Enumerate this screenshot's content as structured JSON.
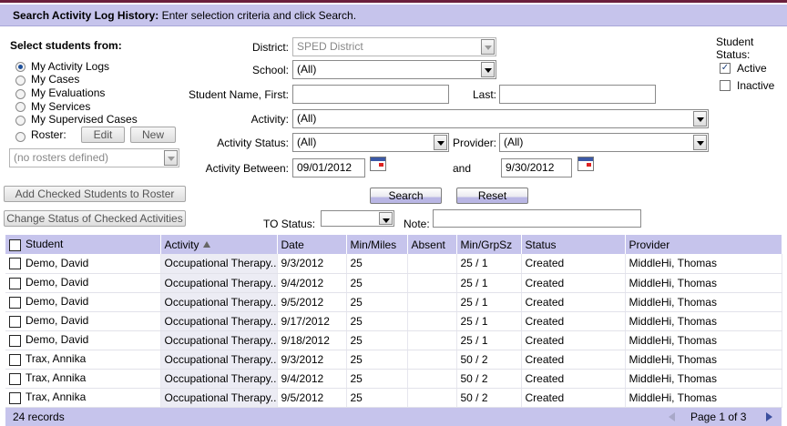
{
  "header": {
    "title": "Search Activity Log History:",
    "instruction": "Enter selection criteria and click Search."
  },
  "select_from": {
    "heading": "Select students from:",
    "options": [
      {
        "label": "My Activity Logs",
        "selected": true
      },
      {
        "label": "My Cases",
        "selected": false
      },
      {
        "label": "My Evaluations",
        "selected": false
      },
      {
        "label": "My Services",
        "selected": false
      },
      {
        "label": "My Supervised Cases",
        "selected": false
      },
      {
        "label": "Roster:",
        "selected": false
      }
    ],
    "edit_label": "Edit",
    "new_label": "New",
    "roster_value": "(no rosters defined)"
  },
  "actions": {
    "add_to_roster": "Add Checked Students to Roster",
    "change_status": "Change Status of Checked Activities"
  },
  "form": {
    "district_label": "District:",
    "district_value": "SPED District",
    "school_label": "School:",
    "school_value": "(All)",
    "first_label": "Student Name, First:",
    "first_value": "",
    "last_label": "Last:",
    "last_value": "",
    "activity_label": "Activity:",
    "activity_value": "(All)",
    "activity_status_label": "Activity Status:",
    "activity_status_value": "(All)",
    "provider_label": "Provider:",
    "provider_value": "(All)",
    "between_label": "Activity Between:",
    "from_date": "09/01/2012",
    "and_label": "and",
    "to_date": "9/30/2012",
    "search_label": "Search",
    "reset_label": "Reset",
    "to_status_label": "TO Status:",
    "to_status_value": "",
    "note_label": "Note:",
    "note_value": ""
  },
  "student_status": {
    "heading_line1": "Student",
    "heading_line2": "Status:",
    "active_label": "Active",
    "active_checked": true,
    "inactive_label": "Inactive",
    "inactive_checked": false
  },
  "table": {
    "columns": [
      "Student",
      "Activity",
      "Date",
      "Min/Miles",
      "Absent",
      "Min/GrpSz",
      "Status",
      "Provider"
    ],
    "sorted_column": "Activity",
    "rows": [
      {
        "student": "Demo, David",
        "activity": "Occupational Therapy...",
        "date": "9/3/2012",
        "min_miles": "25",
        "absent": "",
        "min_grpsz": "25 / 1",
        "status": "Created",
        "provider": "MiddleHi, Thomas"
      },
      {
        "student": "Demo, David",
        "activity": "Occupational Therapy...",
        "date": "9/4/2012",
        "min_miles": "25",
        "absent": "",
        "min_grpsz": "25 / 1",
        "status": "Created",
        "provider": "MiddleHi, Thomas"
      },
      {
        "student": "Demo, David",
        "activity": "Occupational Therapy...",
        "date": "9/5/2012",
        "min_miles": "25",
        "absent": "",
        "min_grpsz": "25 / 1",
        "status": "Created",
        "provider": "MiddleHi, Thomas"
      },
      {
        "student": "Demo, David",
        "activity": "Occupational Therapy...",
        "date": "9/17/2012",
        "min_miles": "25",
        "absent": "",
        "min_grpsz": "25 / 1",
        "status": "Created",
        "provider": "MiddleHi, Thomas"
      },
      {
        "student": "Demo, David",
        "activity": "Occupational Therapy...",
        "date": "9/18/2012",
        "min_miles": "25",
        "absent": "",
        "min_grpsz": "25 / 1",
        "status": "Created",
        "provider": "MiddleHi, Thomas"
      },
      {
        "student": "Trax, Annika",
        "activity": "Occupational Therapy...",
        "date": "9/3/2012",
        "min_miles": "25",
        "absent": "",
        "min_grpsz": "50 / 2",
        "status": "Created",
        "provider": "MiddleHi, Thomas"
      },
      {
        "student": "Trax, Annika",
        "activity": "Occupational Therapy...",
        "date": "9/4/2012",
        "min_miles": "25",
        "absent": "",
        "min_grpsz": "50 / 2",
        "status": "Created",
        "provider": "MiddleHi, Thomas"
      },
      {
        "student": "Trax, Annika",
        "activity": "Occupational Therapy...",
        "date": "9/5/2012",
        "min_miles": "25",
        "absent": "",
        "min_grpsz": "50 / 2",
        "status": "Created",
        "provider": "MiddleHi, Thomas"
      }
    ]
  },
  "footer": {
    "records": "24 records",
    "page_info": "Page 1 of 3"
  },
  "colors": {
    "header_bg": "#c6c4ec",
    "top_accent": "#6b1f3c"
  },
  "icons": [
    "radio-icon",
    "checkbox-icon",
    "dropdown-arrow-icon",
    "calendar-icon",
    "sort-asc-icon",
    "prev-page-icon",
    "next-page-icon"
  ]
}
